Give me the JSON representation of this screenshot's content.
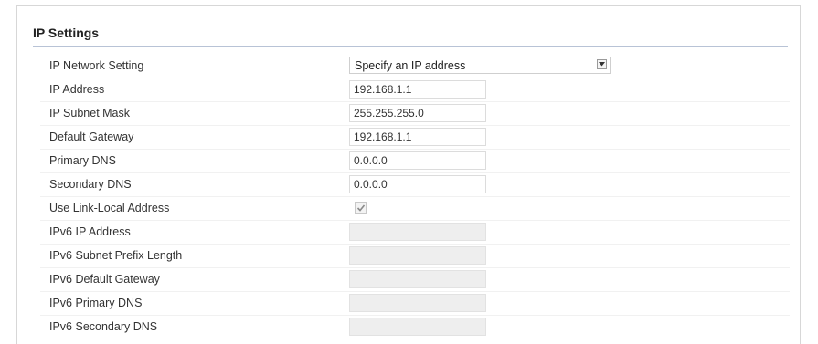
{
  "section": {
    "title": "IP Settings"
  },
  "fields": {
    "network_setting": {
      "label": "IP Network Setting",
      "value": "Specify an IP address"
    },
    "ip_address": {
      "label": "IP Address",
      "value": "192.168.1.1"
    },
    "subnet_mask": {
      "label": "IP Subnet Mask",
      "value": "255.255.255.0"
    },
    "default_gateway": {
      "label": "Default Gateway",
      "value": "192.168.1.1"
    },
    "primary_dns": {
      "label": "Primary DNS",
      "value": "0.0.0.0"
    },
    "secondary_dns": {
      "label": "Secondary DNS",
      "value": "0.0.0.0"
    },
    "link_local": {
      "label": "Use Link-Local Address",
      "checked": true
    },
    "ipv6_address": {
      "label": "IPv6 IP Address",
      "value": ""
    },
    "ipv6_prefix_length": {
      "label": "IPv6 Subnet Prefix Length",
      "value": ""
    },
    "ipv6_gateway": {
      "label": "IPv6 Default Gateway",
      "value": ""
    },
    "ipv6_primary_dns": {
      "label": "IPv6 Primary DNS",
      "value": ""
    },
    "ipv6_secondary_dns": {
      "label": "IPv6 Secondary DNS",
      "value": ""
    }
  },
  "icons": {
    "dropdown": "dropdown-arrow-icon",
    "check": "checkmark-icon"
  },
  "colors": {
    "title_rule": "#b8c3d6",
    "disabled_field": "#eeeeee"
  }
}
